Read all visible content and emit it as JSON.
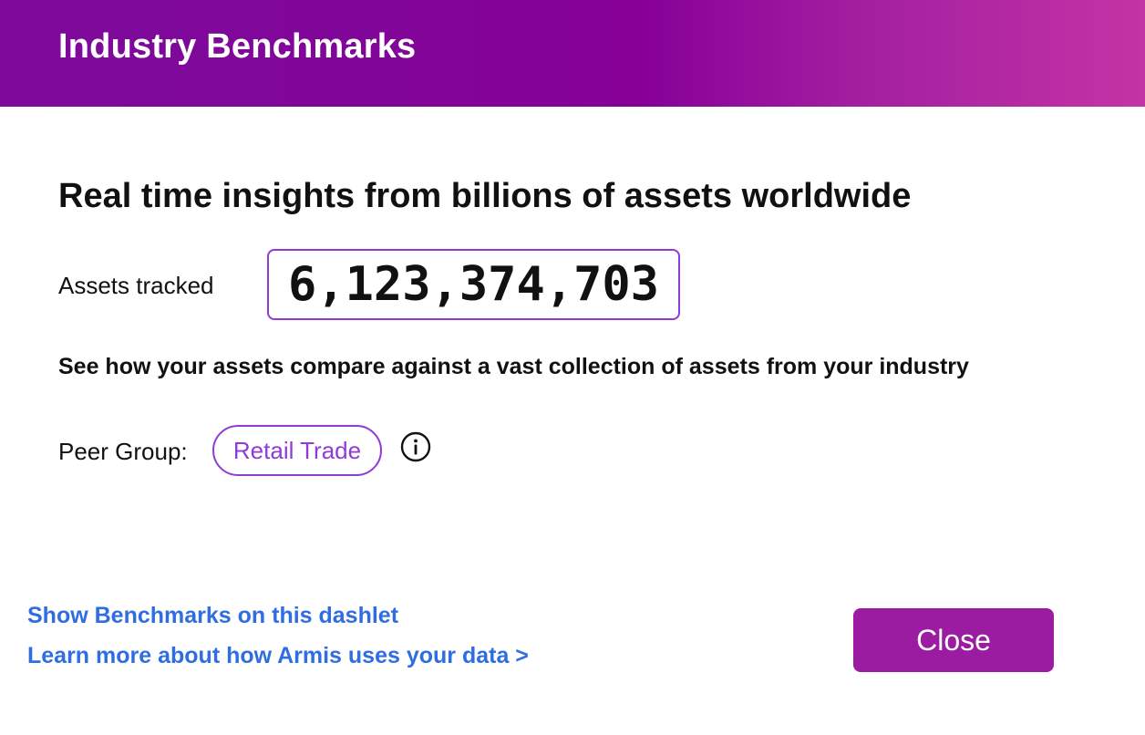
{
  "header": {
    "title": "Industry Benchmarks",
    "gradient_colors": [
      "#7d0a9b",
      "#860098",
      "#c433a5"
    ]
  },
  "main": {
    "headline": "Real time insights from billions of assets worldwide",
    "assets_label": "Assets tracked",
    "assets_count": "6,123,374,703",
    "compare_text": "See how your assets compare against a vast collection of assets from your industry",
    "peer_group_label": "Peer Group:",
    "peer_group_value": "Retail Trade",
    "info_icon": "info-circle-icon"
  },
  "footer": {
    "links": [
      "Show Benchmarks on this dashlet",
      "Learn more about how Armis uses your data >"
    ],
    "close_label": "Close"
  },
  "colors": {
    "accent_purple": "#8e3bd8",
    "close_button": "#9b1ba1",
    "link_blue": "#2f6ee0"
  }
}
